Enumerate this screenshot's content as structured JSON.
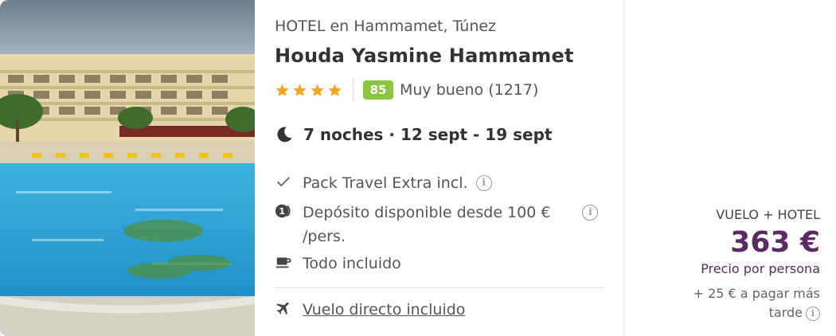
{
  "hotel": {
    "category_location": "HOTEL en Hammamet, Túnez",
    "name": "Houda Yasmine Hammamet",
    "stars": 4,
    "star_icon": "star-icon",
    "review_score": "85",
    "review_text": "Muy bueno (1217)",
    "score_color": "#8cc63f",
    "photo_alt": "Houda Yasmine Hammamet"
  },
  "stay": {
    "icon": "moon-icon",
    "text": "7 noches · 12 sept - 19 sept"
  },
  "features": [
    {
      "icon": "check-icon",
      "text": "Pack Travel Extra incl.",
      "has_info": true
    },
    {
      "icon": "deposit-icon",
      "text_line1": "Depósito disponible desde 100 €",
      "text_line2": "/pers.",
      "has_info": true
    },
    {
      "icon": "coffee-cup-icon",
      "text": "Todo incluido",
      "has_info": false
    }
  ],
  "flight": {
    "icon": "airplane-icon",
    "text": "Vuelo directo incluido"
  },
  "pricing": {
    "type_label": "VUELO + HOTEL",
    "price": "363 €",
    "per_person": "Precio por persona",
    "extra": "+ 25 € a pagar más tarde",
    "accent_color": "#5b2a64"
  },
  "info_glyph": "i"
}
